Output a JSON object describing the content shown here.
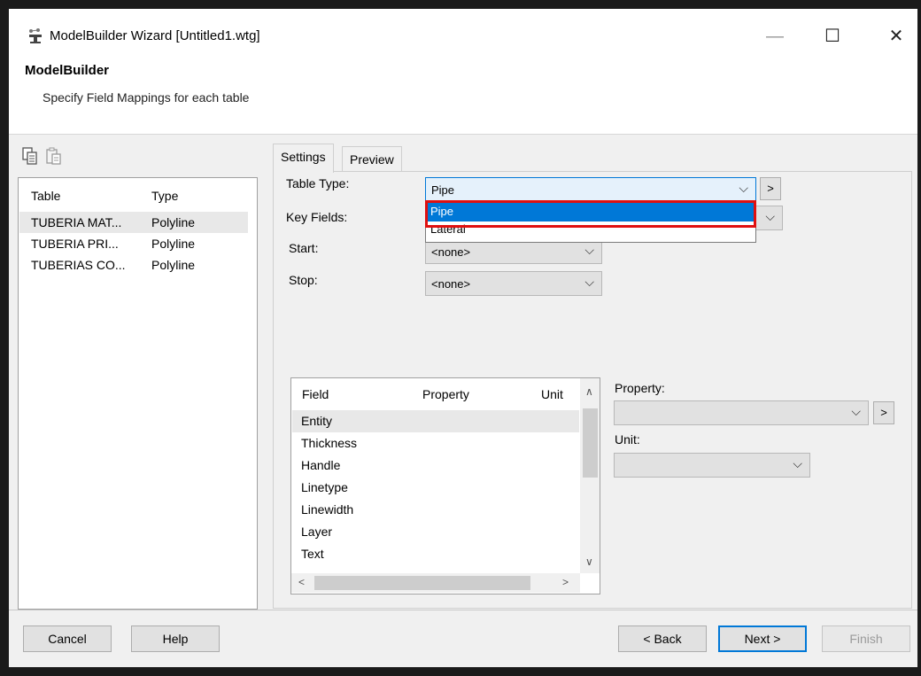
{
  "window": {
    "title": "ModelBuilder Wizard [Untitled1.wtg]",
    "controls": {
      "minimize": "—",
      "maximize": "☐",
      "close": "✕"
    }
  },
  "header": {
    "title": "ModelBuilder",
    "subtitle": "Specify Field Mappings for each table"
  },
  "left_panel": {
    "toolbar_icons": [
      "copy-icon",
      "paste-icon"
    ],
    "columns": [
      "Table",
      "Type"
    ],
    "rows": [
      {
        "table": "TUBERIA MAT...",
        "type": "Polyline"
      },
      {
        "table": "TUBERIA PRI...",
        "type": "Polyline"
      },
      {
        "table": "TUBERIAS CO...",
        "type": "Polyline"
      }
    ]
  },
  "tabs": [
    "Settings",
    "Preview"
  ],
  "settings": {
    "table_type_label": "Table Type:",
    "table_type_value": "Pipe",
    "table_type_options": [
      "Pipe",
      "Lateral"
    ],
    "key_fields_label": "Key Fields:",
    "start_label": "Start:",
    "start_value": "<none>",
    "stop_label": "Stop:",
    "stop_value": "<none>",
    "more_button": ">"
  },
  "field_grid": {
    "columns": [
      "Field",
      "Property",
      "Unit"
    ],
    "rows": [
      "Entity",
      "Thickness",
      "Handle",
      "Linetype",
      "Linewidth",
      "Layer",
      "Text"
    ]
  },
  "property_panel": {
    "property_label": "Property:",
    "property_value": "",
    "unit_label": "Unit:",
    "unit_value": "",
    "more_button": ">"
  },
  "footer": {
    "cancel": "Cancel",
    "help": "Help",
    "back": "< Back",
    "next": "Next >",
    "finish": "Finish"
  },
  "colors": {
    "selection_blue": "#0078d7",
    "highlight_red": "#e01010"
  }
}
